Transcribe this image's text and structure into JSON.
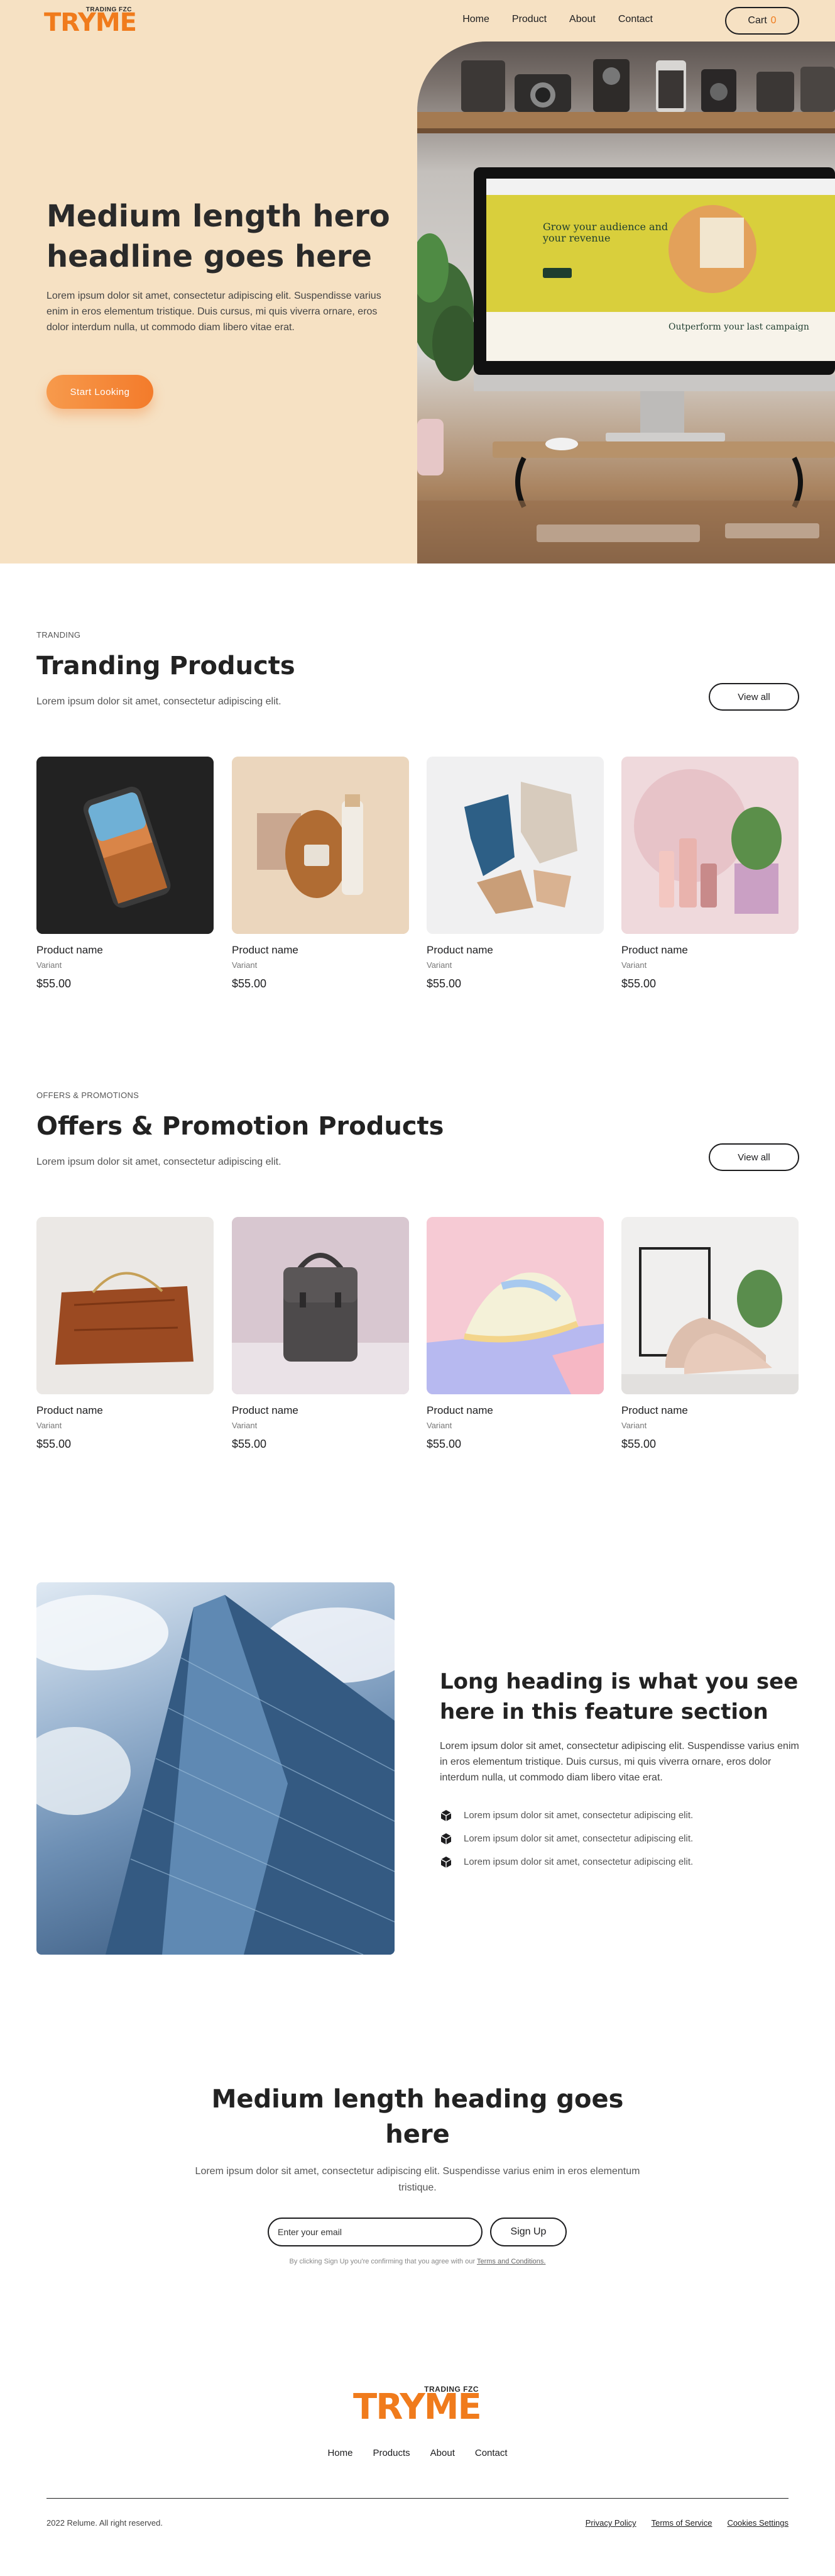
{
  "brand": {
    "name": "TRYME",
    "tagline": "TRADING FZC",
    "accent": "#f07b1c"
  },
  "nav": {
    "links": [
      "Home",
      "Product",
      "About",
      "Contact"
    ],
    "cart_label": "Cart",
    "cart_count": "0"
  },
  "hero": {
    "title": "Medium length hero headline goes here",
    "description": "Lorem ipsum dolor sit amet, consectetur adipiscing elit. Suspendisse varius enim in eros elementum tristique. Duis cursus, mi quis viverra ornare, eros dolor interdum nulla, ut commodo diam libero vitae erat.",
    "cta_label": "Start Looking"
  },
  "trending": {
    "eyebrow": "TRANDING",
    "title": "Tranding Products",
    "description": "Lorem ipsum dolor sit amet, consectetur adipiscing elit.",
    "view_all_label": "View all",
    "products": [
      {
        "name": "Product name",
        "variant": "Variant",
        "price": "$55.00"
      },
      {
        "name": "Product name",
        "variant": "Variant",
        "price": "$55.00"
      },
      {
        "name": "Product name",
        "variant": "Variant",
        "price": "$55.00"
      },
      {
        "name": "Product name",
        "variant": "Variant",
        "price": "$55.00"
      }
    ]
  },
  "offers": {
    "eyebrow": "OFFERS & PROMOTIONS",
    "title": "Offers & Promotion Products",
    "description": "Lorem ipsum dolor sit amet, consectetur adipiscing elit.",
    "view_all_label": "View all",
    "products": [
      {
        "name": "Product name",
        "variant": "Variant",
        "price": "$55.00"
      },
      {
        "name": "Product name",
        "variant": "Variant",
        "price": "$55.00"
      },
      {
        "name": "Product name",
        "variant": "Variant",
        "price": "$55.00"
      },
      {
        "name": "Product name",
        "variant": "Variant",
        "price": "$55.00"
      }
    ]
  },
  "feature": {
    "title": "Long heading is what you see here in this feature section",
    "description": "Lorem ipsum dolor sit amet, consectetur adipiscing elit. Suspendisse varius enim in eros elementum tristique. Duis cursus, mi quis viverra ornare, eros dolor interdum nulla, ut commodo diam libero vitae erat.",
    "items": [
      "Lorem ipsum dolor sit amet, consectetur adipiscing elit.",
      "Lorem ipsum dolor sit amet, consectetur adipiscing elit.",
      "Lorem ipsum dolor sit amet, consectetur adipiscing elit."
    ]
  },
  "cta": {
    "title": "Medium length heading goes here",
    "description": "Lorem ipsum dolor sit amet, consectetur adipiscing elit. Suspendisse varius enim in eros elementum tristique.",
    "email_placeholder": "Enter your email",
    "signup_label": "Sign Up",
    "terms_prefix": "By clicking Sign Up you're confirming that you agree with our",
    "terms_link": "Terms and Conditions."
  },
  "footer": {
    "links": [
      "Home",
      "Products",
      "About",
      "Contact"
    ],
    "copyright": "2022 Relume. All right reserved.",
    "legal": [
      "Privacy Policy",
      "Terms of Service",
      "Cookies Settings"
    ]
  }
}
